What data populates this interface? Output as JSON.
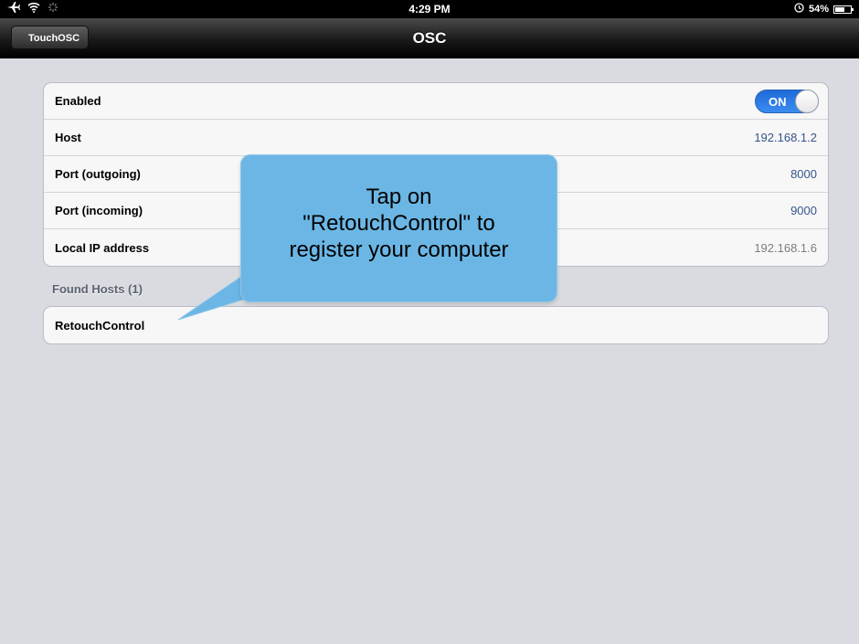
{
  "status_bar": {
    "time": "4:29 PM",
    "battery": "54%",
    "icons": [
      "airplane-icon",
      "wifi-icon",
      "activity-icon",
      "alarm-icon",
      "battery-icon"
    ]
  },
  "nav": {
    "back_label": "TouchOSC",
    "title": "OSC"
  },
  "settings": {
    "enabled_label": "Enabled",
    "toggle_text": "ON",
    "rows": [
      {
        "label": "Host",
        "value": "192.168.1.2"
      },
      {
        "label": "Port (outgoing)",
        "value": "8000"
      },
      {
        "label": "Port (incoming)",
        "value": "9000"
      },
      {
        "label": "Local IP address",
        "value": "192.168.1.6"
      }
    ]
  },
  "found_hosts": {
    "header": "Found Hosts (1)",
    "items": [
      "RetouchControl"
    ]
  },
  "callout": {
    "line1": "Tap on",
    "line2": "\"RetouchControl\" to",
    "line3": "register your computer"
  },
  "colors": {
    "toggle_on": "#2f7de6",
    "callout": "#6bb6e4",
    "value_text": "#36548a"
  }
}
